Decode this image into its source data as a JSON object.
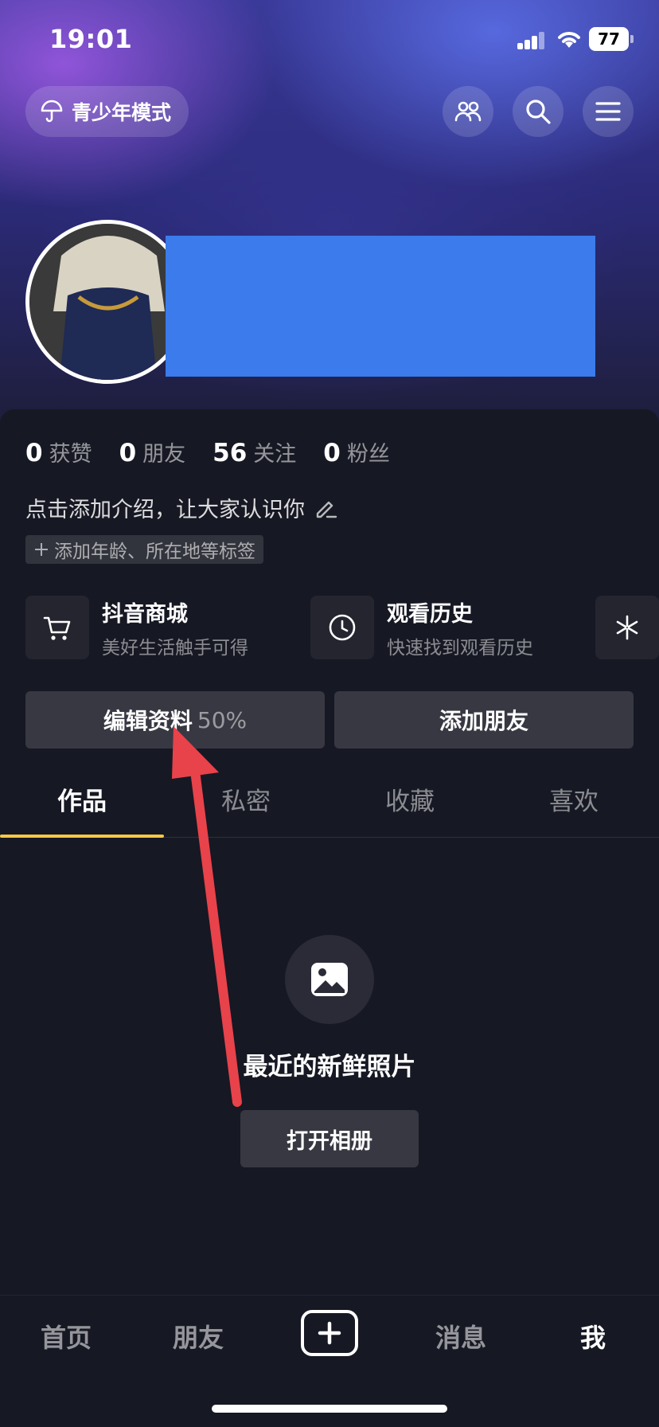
{
  "status_bar": {
    "time": "19:01",
    "battery": "77"
  },
  "header": {
    "teen_mode_label": "青少年模式"
  },
  "profile": {
    "stats": [
      {
        "num": "0",
        "label": "获赞"
      },
      {
        "num": "0",
        "label": "朋友"
      },
      {
        "num": "56",
        "label": "关注"
      },
      {
        "num": "0",
        "label": "粉丝"
      }
    ],
    "bio_placeholder": "点击添加介绍，让大家认识你",
    "tag_chip": "添加年龄、所在地等标签"
  },
  "features": [
    {
      "title": "抖音商城",
      "subtitle": "美好生活触手可得",
      "icon": "cart-icon"
    },
    {
      "title": "观看历史",
      "subtitle": "快速找到观看历史",
      "icon": "clock-icon"
    },
    {
      "icon": "sparkle-icon"
    }
  ],
  "actions": {
    "edit_profile": "编辑资料",
    "edit_progress": "50%",
    "add_friend": "添加朋友"
  },
  "tabs": [
    "作品",
    "私密",
    "收藏",
    "喜欢"
  ],
  "active_tab": "作品",
  "empty_state": {
    "title": "最近的新鲜照片",
    "button": "打开相册",
    "icon": "image-icon"
  },
  "bottom_nav": {
    "home": "首页",
    "friends": "朋友",
    "messages": "消息",
    "me": "我",
    "active": "我"
  },
  "colors": {
    "accent_underline": "#f5c945",
    "annotation_arrow": "#e8424a",
    "redaction": "#3b7bec"
  }
}
